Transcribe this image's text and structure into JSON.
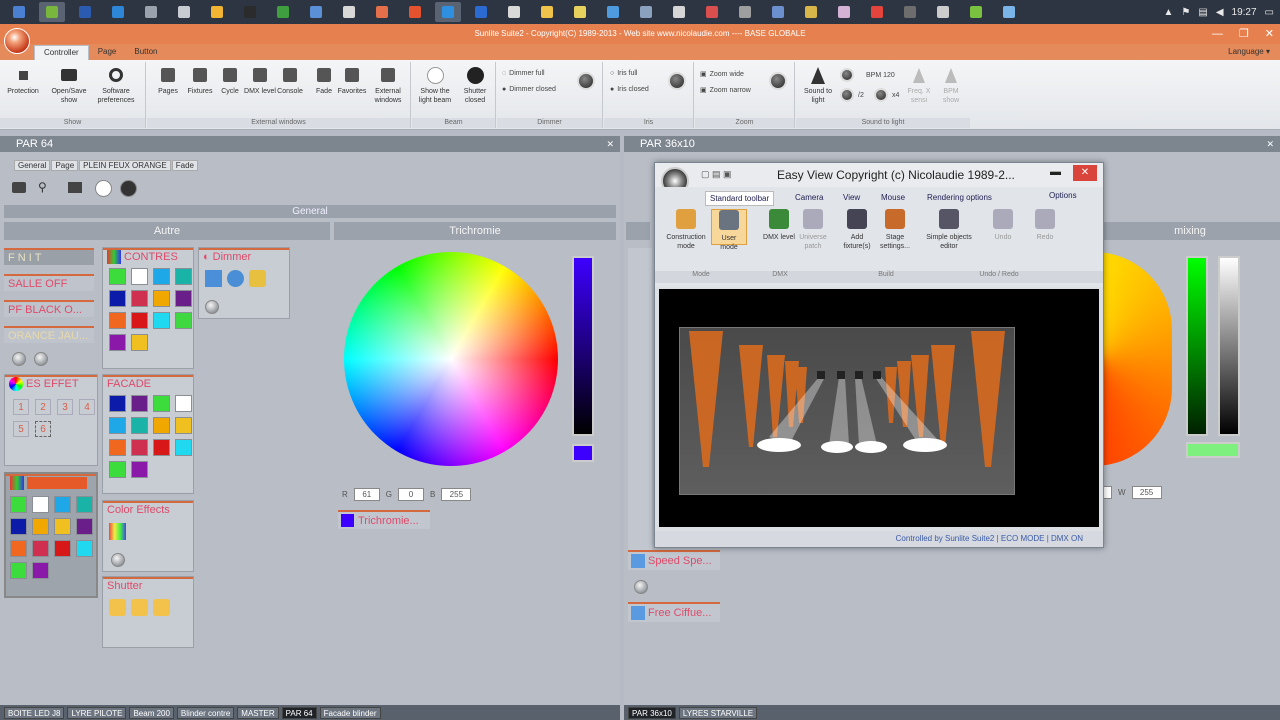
{
  "taskbar": {
    "clock": "19:27",
    "icons": [
      "#4a7fd1",
      "#79b63d",
      "#2a5bb0",
      "#2d86d8",
      "#9aa3ad",
      "#c7ccd3",
      "#f2b533",
      "#2b2b2b",
      "#3f9f3f",
      "#5b8fd6",
      "#d8d8d8",
      "#e56f4a",
      "#e4522e",
      "#2f8fe0",
      "#2b6ad0",
      "#d9d9d9",
      "#f0c34a",
      "#e8d25e",
      "#4f9be0",
      "#8aa2be",
      "#d6d6d6",
      "#d94f4f",
      "#9e9e9e",
      "#6c8fcf",
      "#d8b64a",
      "#d4b2d6",
      "#e3443c",
      "#6d6d6d",
      "#cccccc",
      "#79c240",
      "#7bb4e6",
      "#9aa",
      "#adb",
      "#cde"
    ]
  },
  "window": {
    "title": "Sunlite Suite2 - Copyright(C) 1989-2013 - Web site www.nicolaudie.com ---- BASE GLOBALE",
    "tabs": [
      "Controller",
      "Page",
      "Button"
    ],
    "language": "Language"
  },
  "ribbon": {
    "groups": [
      "Show",
      "External windows",
      "Beam",
      "Dimmer",
      "Iris",
      "Zoom",
      "Sound to light"
    ],
    "show_buttons": [
      "Protection",
      "Open/Save show",
      "Software preferences"
    ],
    "ext_buttons": [
      "Pages",
      "Fixtures",
      "Cycle",
      "DMX level",
      "Console",
      "Fade",
      "Favorites",
      "External windows"
    ],
    "beam_buttons": [
      "Show the light beam",
      "Shutter closed"
    ],
    "dimmer": [
      "Dimmer full",
      "Dimmer closed"
    ],
    "iris": [
      "Iris full",
      "Iris closed"
    ],
    "zoom": [
      "Zoom wide",
      "Zoom narrow"
    ],
    "sound": {
      "btn": "Sound to light",
      "bpm": "BPM 120",
      "half": "/2",
      "x2": "x4",
      "freq": "Freq. X sensi",
      "bpm2": "BPM show"
    }
  },
  "left_panel": {
    "title": "PAR 64",
    "subtabs": [
      "General",
      "Page",
      "PLEIN FEUX ORANGE",
      "Fade"
    ],
    "section": "General",
    "columns": [
      "Autre",
      "Trichromie"
    ],
    "cues": [
      "F N I T",
      "SALLE OFF",
      "PF BLACK O...",
      "ORANCE JAU..."
    ],
    "boxes": {
      "contres": "CONTRES",
      "dimmer": "Dimmer",
      "effet": "ES EFFET",
      "facade": "FACADE",
      "color_effects": "Color Effects",
      "shutter": "Shutter"
    },
    "effet_numbers": [
      "1",
      "2",
      "3",
      "4",
      "5",
      "6"
    ],
    "rgb": {
      "r_label": "R",
      "r": "61",
      "g_label": "G",
      "g": "0",
      "b_label": "B",
      "b": "255"
    },
    "trichromie_cue": "Trichromie..."
  },
  "right_panel": {
    "title": "PAR 36x10",
    "column": "mixing",
    "w_label": "W",
    "w": "255",
    "cues": [
      "Speed Spe...",
      "Free Ciffue..."
    ]
  },
  "easyview": {
    "title": "Easy View   Copyright (c) Nicolaudie 1989-2...",
    "tabs": [
      "Standard toolbar",
      "Camera",
      "View",
      "Mouse",
      "Rendering options"
    ],
    "options": "Options",
    "buttons": [
      "Construction mode",
      "User mode",
      "DMX level",
      "Universe patch",
      "Add fixture(s)",
      "Stage settings...",
      "Simple objects editor",
      "Undo",
      "Redo"
    ],
    "groups": [
      "Mode",
      "DMX",
      "Build",
      "Undo / Redo"
    ],
    "status": "Controlled by Sunlite Suite2  |  ECO MODE  |  DMX ON"
  },
  "bottom_left": [
    "BOITE LED J8",
    "LYRE PILOTE",
    "Beam 200",
    "Blinder contre",
    "MASTER",
    "PAR 64",
    "Facade blinder"
  ],
  "bottom_right": [
    "PAR 36x10",
    "LYRES STARVILLE"
  ]
}
